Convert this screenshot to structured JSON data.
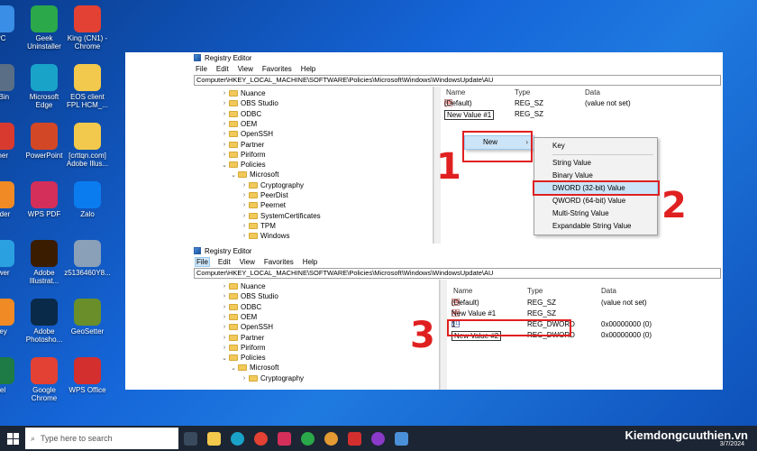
{
  "desktop": {
    "icons": [
      {
        "label": "PC",
        "color": "#3a8ee6"
      },
      {
        "label": "Geek\nUninstaller",
        "color": "#2aa84a"
      },
      {
        "label": "King (CN1) -\nChrome",
        "color": "#e34133"
      },
      {
        "label": "e Bin",
        "color": "#5a6f85"
      },
      {
        "label": "Microsoft\nEdge",
        "color": "#1aa3c9"
      },
      {
        "label": "EOS client\nFPL HCM_...",
        "color": "#f2c94c"
      },
      {
        "label": "aner",
        "color": "#d93a2f"
      },
      {
        "label": "PowerPoint",
        "color": "#d24726"
      },
      {
        "label": "[crttqn.com]\nAdobe Illus...",
        "color": "#f2c94c"
      },
      {
        "label": "eader",
        "color": "#f08a24"
      },
      {
        "label": "WPS PDF",
        "color": "#d32f5a"
      },
      {
        "label": "Zalo",
        "color": "#0a7cf0"
      },
      {
        "label": "iewer",
        "color": "#2aa0e0"
      },
      {
        "label": "Adobe\nIllustrat...",
        "color": "#3a1c00"
      },
      {
        "label": "z5136460Y8...",
        "color": "#8aa0b8"
      },
      {
        "label": "Key",
        "color": "#f08a24"
      },
      {
        "label": "Adobe\nPhotosho...",
        "color": "#0a2a4a"
      },
      {
        "label": "GeoSetter",
        "color": "#6a8f2a"
      },
      {
        "label": "cel",
        "color": "#1e7b45"
      },
      {
        "label": "Google\nChrome",
        "color": "#e34133"
      },
      {
        "label": "WPS Office",
        "color": "#d32f2f"
      }
    ]
  },
  "window1": {
    "title": "Registry Editor",
    "menu": [
      "File",
      "Edit",
      "View",
      "Favorites",
      "Help"
    ],
    "address": "Computer\\HKEY_LOCAL_MACHINE\\SOFTWARE\\Policies\\Microsoft\\Windows\\WindowsUpdate\\AU",
    "tree": [
      "Nuance",
      "OBS Studio",
      "ODBC",
      "OEM",
      "OpenSSH",
      "Partner",
      "Piriform",
      "Policies",
      "Microsoft",
      "Cryptography",
      "PeerDist",
      "Peernet",
      "SystemCertificates",
      "TPM",
      "Windows"
    ],
    "columns": {
      "name": "Name",
      "type": "Type",
      "data": "Data"
    },
    "rows": [
      {
        "name": "(Default)",
        "type": "REG_SZ",
        "data": "(value not set)",
        "icon": "ab"
      },
      {
        "name": "New Value #1",
        "type": "REG_SZ",
        "data": "",
        "icon": "ab"
      }
    ]
  },
  "context": {
    "new_label": "New",
    "submenu": [
      "Key",
      "String Value",
      "Binary Value",
      "DWORD (32-bit) Value",
      "QWORD (64-bit) Value",
      "Multi-String Value",
      "Expandable String Value"
    ]
  },
  "window2": {
    "title": "Registry Editor",
    "menu": [
      "File",
      "Edit",
      "View",
      "Favorites",
      "Help"
    ],
    "address": "Computer\\HKEY_LOCAL_MACHINE\\SOFTWARE\\Policies\\Microsoft\\Windows\\WindowsUpdate\\AU",
    "tree": [
      "Nuance",
      "OBS Studio",
      "ODBC",
      "OEM",
      "OpenSSH",
      "Partner",
      "Piriform",
      "Policies",
      "Microsoft",
      "Cryptography"
    ],
    "columns": {
      "name": "Name",
      "type": "Type",
      "data": "Data"
    },
    "rows": [
      {
        "name": "(Default)",
        "type": "REG_SZ",
        "data": "(value not set)",
        "icon": "ab"
      },
      {
        "name": "New Value #1",
        "type": "REG_SZ",
        "data": "",
        "icon": "ab"
      },
      {
        "name": "1",
        "type": "REG_DWORD",
        "data": "0x00000000 (0)",
        "icon": "011"
      },
      {
        "name": "New Value #2",
        "type": "REG_DWORD",
        "data": "0x00000000 (0)",
        "icon": "011"
      }
    ]
  },
  "steps": [
    "1",
    "2",
    "3"
  ],
  "taskbar": {
    "search_placeholder": "Type here to search",
    "brand": "Kiemdongcuuthien.vn",
    "date": "3/7/2024"
  },
  "colors": {
    "accent_red": "#e02020",
    "taskbar": "#1c2533"
  }
}
